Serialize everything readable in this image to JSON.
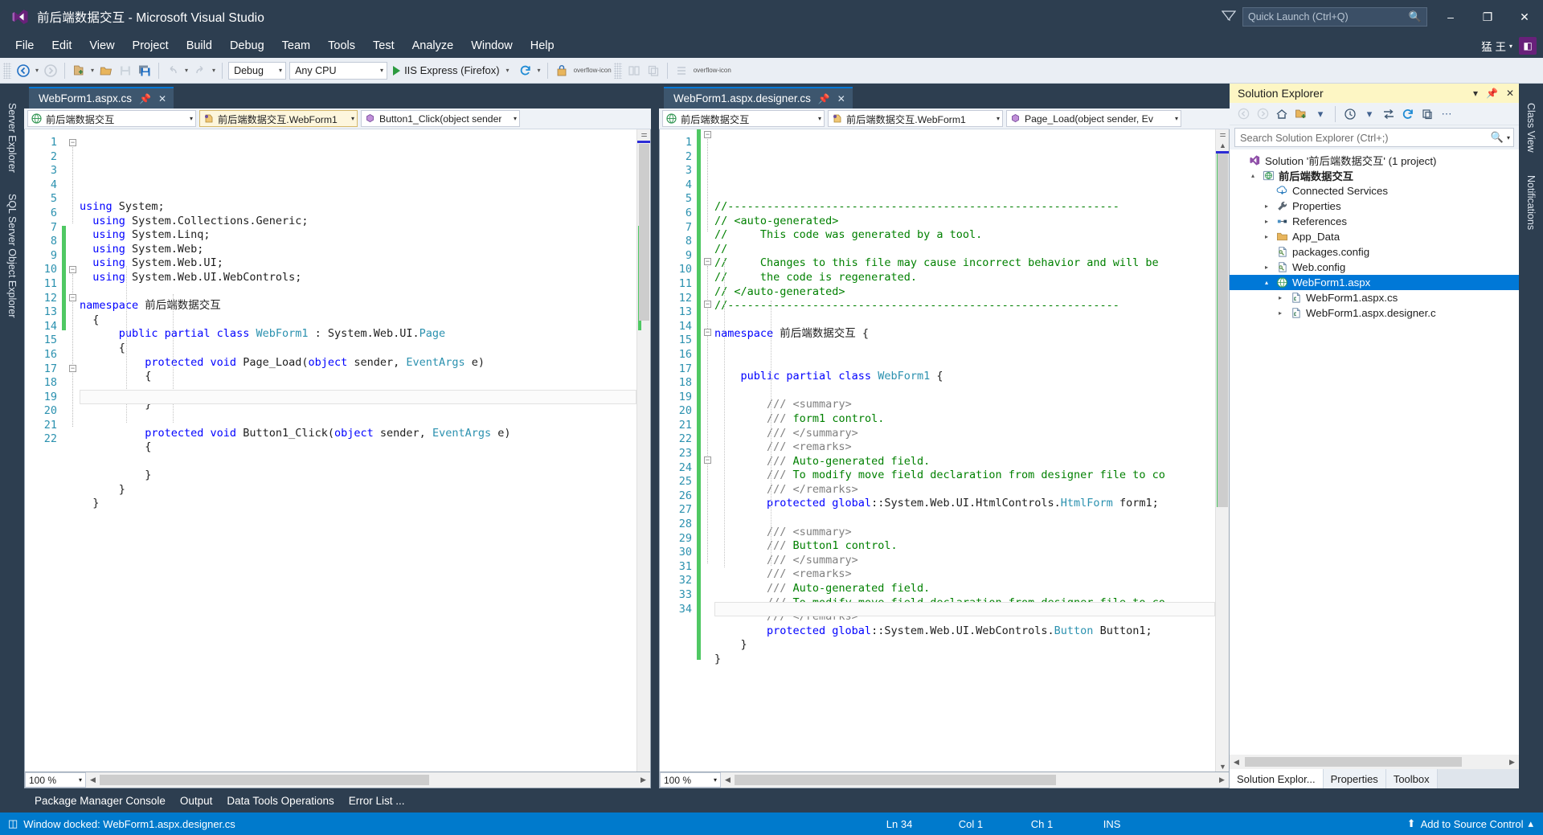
{
  "window": {
    "title": "前后端数据交互 - Microsoft Visual Studio",
    "logo_icon": "visual-studio-logo",
    "feedback_icon": "feedback-icon",
    "minimize_label": "–",
    "maximize_label": "❐",
    "close_label": "✕"
  },
  "quick_launch": {
    "placeholder": "Quick Launch (Ctrl+Q)",
    "icon": "search-icon"
  },
  "menu": {
    "items": [
      {
        "label": "File"
      },
      {
        "label": "Edit"
      },
      {
        "label": "View"
      },
      {
        "label": "Project"
      },
      {
        "label": "Build"
      },
      {
        "label": "Debug"
      },
      {
        "label": "Team"
      },
      {
        "label": "Tools"
      },
      {
        "label": "Test"
      },
      {
        "label": "Analyze"
      },
      {
        "label": "Window"
      },
      {
        "label": "Help"
      }
    ],
    "user": "猛 王",
    "user_caret": "▾",
    "badge": "◧"
  },
  "toolbar": {
    "nav_back_icon": "navigate-back-icon",
    "nav_forward_icon": "navigate-forward-icon",
    "new_project_icon": "new-project-icon",
    "open_file_icon": "open-file-icon",
    "save_icon": "save-icon",
    "save_all_icon": "save-all-icon",
    "undo_icon": "undo-icon",
    "redo_icon": "redo-icon",
    "config_value": "Debug",
    "platform_value": "Any CPU",
    "run_label": "IIS Express (Firefox)",
    "run_icon": "play-icon",
    "refresh_icon": "refresh-icon",
    "attach_icon": "attach-process-icon",
    "caret": "▾",
    "more_icon": "overflow-icon"
  },
  "left_pane": {
    "tab": {
      "label": "WebForm1.aspx.cs",
      "pin_icon": "pin-icon",
      "close_icon": "close-icon"
    },
    "nav": {
      "project": "前后端数据交互",
      "project_icon": "project-icon",
      "type": "前后端数据交互.WebForm1",
      "type_icon": "class-icon",
      "member": "Button1_Click(object sender",
      "member_icon": "method-icon",
      "caret": "▾"
    },
    "zoom": "100 %",
    "line_count": 22,
    "lines": [
      {
        "n": 1,
        "tokens": [
          {
            "t": "using ",
            "c": "kw"
          },
          {
            "t": "System;",
            "c": ""
          }
        ]
      },
      {
        "n": 2,
        "tokens": [
          {
            "t": "  using ",
            "c": "kw"
          },
          {
            "t": "System.Collections.Generic;",
            "c": ""
          }
        ]
      },
      {
        "n": 3,
        "tokens": [
          {
            "t": "  using ",
            "c": "kw"
          },
          {
            "t": "System.Linq;",
            "c": ""
          }
        ]
      },
      {
        "n": 4,
        "tokens": [
          {
            "t": "  using ",
            "c": "kw"
          },
          {
            "t": "System.Web;",
            "c": ""
          }
        ]
      },
      {
        "n": 5,
        "tokens": [
          {
            "t": "  using ",
            "c": "kw"
          },
          {
            "t": "System.Web.UI;",
            "c": ""
          }
        ]
      },
      {
        "n": 6,
        "tokens": [
          {
            "t": "  using ",
            "c": "kw"
          },
          {
            "t": "System.Web.UI.WebControls;",
            "c": ""
          }
        ]
      },
      {
        "n": 7,
        "tokens": []
      },
      {
        "n": 8,
        "tokens": [
          {
            "t": "namespace ",
            "c": "kw"
          },
          {
            "t": "前后端数据交互",
            "c": ""
          }
        ]
      },
      {
        "n": 9,
        "tokens": [
          {
            "t": "  {",
            "c": ""
          }
        ]
      },
      {
        "n": 10,
        "tokens": [
          {
            "t": "      public partial class ",
            "c": "kw"
          },
          {
            "t": "WebForm1",
            "c": "type"
          },
          {
            "t": " : System.Web.UI.",
            "c": ""
          },
          {
            "t": "Page",
            "c": "type"
          }
        ]
      },
      {
        "n": 11,
        "tokens": [
          {
            "t": "      {",
            "c": ""
          }
        ]
      },
      {
        "n": 12,
        "tokens": [
          {
            "t": "          protected void ",
            "c": "kw"
          },
          {
            "t": "Page_Load(",
            "c": ""
          },
          {
            "t": "object",
            "c": "kw"
          },
          {
            "t": " sender, ",
            "c": ""
          },
          {
            "t": "EventArgs",
            "c": "type"
          },
          {
            "t": " e)",
            "c": ""
          }
        ]
      },
      {
        "n": 13,
        "tokens": [
          {
            "t": "          {",
            "c": ""
          }
        ]
      },
      {
        "n": 14,
        "tokens": []
      },
      {
        "n": 15,
        "tokens": [
          {
            "t": "          }",
            "c": ""
          }
        ]
      },
      {
        "n": 16,
        "tokens": []
      },
      {
        "n": 17,
        "tokens": [
          {
            "t": "          protected void ",
            "c": "kw"
          },
          {
            "t": "Button1_Click(",
            "c": ""
          },
          {
            "t": "object",
            "c": "kw"
          },
          {
            "t": " sender, ",
            "c": ""
          },
          {
            "t": "EventArgs",
            "c": "type"
          },
          {
            "t": " e)",
            "c": ""
          }
        ]
      },
      {
        "n": 18,
        "tokens": [
          {
            "t": "          {",
            "c": ""
          }
        ]
      },
      {
        "n": 19,
        "tokens": []
      },
      {
        "n": 20,
        "tokens": [
          {
            "t": "          }",
            "c": ""
          }
        ]
      },
      {
        "n": 21,
        "tokens": [
          {
            "t": "      }",
            "c": ""
          }
        ]
      },
      {
        "n": 22,
        "tokens": [
          {
            "t": "  }",
            "c": ""
          }
        ]
      }
    ]
  },
  "right_pane": {
    "tab": {
      "label": "WebForm1.aspx.designer.cs",
      "pin_icon": "pin-icon",
      "close_icon": "close-icon"
    },
    "nav": {
      "project": "前后端数据交互",
      "project_icon": "project-icon",
      "type": "前后端数据交互.WebForm1",
      "type_icon": "class-icon",
      "member": "Page_Load(object sender, Ev",
      "member_icon": "method-icon",
      "caret": "▾"
    },
    "zoom": "100 %",
    "line_count": 34,
    "lines": [
      {
        "n": 1,
        "tokens": [
          {
            "t": "//------------------------------------------------------------",
            "c": "cmt"
          }
        ]
      },
      {
        "n": 2,
        "tokens": [
          {
            "t": "// <auto-generated>",
            "c": "cmt"
          }
        ]
      },
      {
        "n": 3,
        "tokens": [
          {
            "t": "//     This code was generated by a tool.",
            "c": "cmt"
          }
        ]
      },
      {
        "n": 4,
        "tokens": [
          {
            "t": "//",
            "c": "cmt"
          }
        ]
      },
      {
        "n": 5,
        "tokens": [
          {
            "t": "//     Changes to this file may cause incorrect behavior and will be ",
            "c": "cmt"
          }
        ]
      },
      {
        "n": 6,
        "tokens": [
          {
            "t": "//     the code is regenerated.",
            "c": "cmt"
          }
        ]
      },
      {
        "n": 7,
        "tokens": [
          {
            "t": "// </auto-generated>",
            "c": "cmt"
          }
        ]
      },
      {
        "n": 8,
        "tokens": [
          {
            "t": "//------------------------------------------------------------",
            "c": "cmt"
          }
        ]
      },
      {
        "n": 9,
        "tokens": []
      },
      {
        "n": 10,
        "tokens": [
          {
            "t": "namespace ",
            "c": "kw"
          },
          {
            "t": "前后端数据交互 {",
            "c": ""
          }
        ]
      },
      {
        "n": 11,
        "tokens": []
      },
      {
        "n": 12,
        "tokens": []
      },
      {
        "n": 13,
        "tokens": [
          {
            "t": "    public partial class ",
            "c": "kw"
          },
          {
            "t": "WebForm1",
            "c": "type"
          },
          {
            "t": " {",
            "c": ""
          }
        ]
      },
      {
        "n": 14,
        "tokens": []
      },
      {
        "n": 15,
        "tokens": [
          {
            "t": "        /// ",
            "c": "cmtdoc"
          },
          {
            "t": "<summary>",
            "c": "cmtdoc"
          }
        ]
      },
      {
        "n": 16,
        "tokens": [
          {
            "t": "        /// ",
            "c": "cmtdoc"
          },
          {
            "t": "form1 control.",
            "c": "cmt"
          }
        ]
      },
      {
        "n": 17,
        "tokens": [
          {
            "t": "        /// </summary>",
            "c": "cmtdoc"
          }
        ]
      },
      {
        "n": 18,
        "tokens": [
          {
            "t": "        /// <remarks>",
            "c": "cmtdoc"
          }
        ]
      },
      {
        "n": 19,
        "tokens": [
          {
            "t": "        /// ",
            "c": "cmtdoc"
          },
          {
            "t": "Auto-generated field.",
            "c": "cmt"
          }
        ]
      },
      {
        "n": 20,
        "tokens": [
          {
            "t": "        /// ",
            "c": "cmtdoc"
          },
          {
            "t": "To modify move field declaration from designer file to co",
            "c": "cmt"
          }
        ]
      },
      {
        "n": 21,
        "tokens": [
          {
            "t": "        /// </remarks>",
            "c": "cmtdoc"
          }
        ]
      },
      {
        "n": 22,
        "tokens": [
          {
            "t": "        protected global",
            "c": "kw"
          },
          {
            "t": "::System.Web.UI.HtmlControls.",
            "c": ""
          },
          {
            "t": "HtmlForm",
            "c": "type"
          },
          {
            "t": " form1;",
            "c": ""
          }
        ]
      },
      {
        "n": 23,
        "tokens": []
      },
      {
        "n": 24,
        "tokens": [
          {
            "t": "        /// <summary>",
            "c": "cmtdoc"
          }
        ]
      },
      {
        "n": 25,
        "tokens": [
          {
            "t": "        /// ",
            "c": "cmtdoc"
          },
          {
            "t": "Button1 control.",
            "c": "cmt"
          }
        ]
      },
      {
        "n": 26,
        "tokens": [
          {
            "t": "        /// </summary>",
            "c": "cmtdoc"
          }
        ]
      },
      {
        "n": 27,
        "tokens": [
          {
            "t": "        /// <remarks>",
            "c": "cmtdoc"
          }
        ]
      },
      {
        "n": 28,
        "tokens": [
          {
            "t": "        /// ",
            "c": "cmtdoc"
          },
          {
            "t": "Auto-generated field.",
            "c": "cmt"
          }
        ]
      },
      {
        "n": 29,
        "tokens": [
          {
            "t": "        /// ",
            "c": "cmtdoc"
          },
          {
            "t": "To modify move field declaration from designer file to co",
            "c": "cmt"
          }
        ]
      },
      {
        "n": 30,
        "tokens": [
          {
            "t": "        /// </remarks>",
            "c": "cmtdoc"
          }
        ]
      },
      {
        "n": 31,
        "tokens": [
          {
            "t": "        protected global",
            "c": "kw"
          },
          {
            "t": "::System.Web.UI.WebControls.",
            "c": ""
          },
          {
            "t": "Button",
            "c": "type"
          },
          {
            "t": " Button1;",
            "c": ""
          }
        ]
      },
      {
        "n": 32,
        "tokens": [
          {
            "t": "    }",
            "c": ""
          }
        ]
      },
      {
        "n": 33,
        "tokens": [
          {
            "t": "}",
            "c": ""
          }
        ]
      },
      {
        "n": 34,
        "tokens": []
      }
    ]
  },
  "left_dock": {
    "tabs": [
      "Server Explorer",
      "SQL Server Object Explorer"
    ]
  },
  "right_dock": {
    "tabs": [
      "Class View",
      "Notifications"
    ]
  },
  "solution_explorer": {
    "title": "Solution Explorer",
    "menu_caret": "▾",
    "pin_icon": "pin-icon",
    "close_icon": "close-icon",
    "toolbar_icons": [
      "back-icon",
      "forward-icon",
      "home-icon",
      "new-folder-icon",
      "dropdown-caret-icon",
      "pending-changes-icon",
      "sync-icon",
      "refresh-icon",
      "collapse-all-icon",
      "overflow-icon"
    ],
    "search_placeholder": "Search Solution Explorer (Ctrl+;)",
    "search_icon": "search-icon",
    "tree": [
      {
        "label": "Solution '前后端数据交互' (1 project)",
        "indent": 0,
        "arrow": "",
        "icon": "solution-icon",
        "selected": false,
        "bold": false
      },
      {
        "label": "前后端数据交互",
        "indent": 1,
        "arrow": "▴",
        "icon": "web-project-icon",
        "selected": false,
        "bold": true
      },
      {
        "label": "Connected Services",
        "indent": 2,
        "arrow": "",
        "icon": "connected-services-icon",
        "selected": false,
        "bold": false
      },
      {
        "label": "Properties",
        "indent": 2,
        "arrow": "▸",
        "icon": "wrench-icon",
        "selected": false,
        "bold": false
      },
      {
        "label": "References",
        "indent": 2,
        "arrow": "▸",
        "icon": "references-icon",
        "selected": false,
        "bold": false
      },
      {
        "label": "App_Data",
        "indent": 2,
        "arrow": "▸",
        "icon": "folder-icon",
        "selected": false,
        "bold": false
      },
      {
        "label": "packages.config",
        "indent": 2,
        "arrow": "",
        "icon": "config-file-icon",
        "selected": false,
        "bold": false
      },
      {
        "label": "Web.config",
        "indent": 2,
        "arrow": "▸",
        "icon": "config-file-icon",
        "selected": false,
        "bold": false
      },
      {
        "label": "WebForm1.aspx",
        "indent": 2,
        "arrow": "▴",
        "icon": "web-form-icon",
        "selected": true,
        "bold": false
      },
      {
        "label": "WebForm1.aspx.cs",
        "indent": 3,
        "arrow": "▸",
        "icon": "csharp-file-icon",
        "selected": false,
        "bold": false
      },
      {
        "label": "WebForm1.aspx.designer.c",
        "indent": 3,
        "arrow": "▸",
        "icon": "csharp-file-icon",
        "selected": false,
        "bold": false
      }
    ],
    "bottom_tabs": [
      {
        "label": "Solution Explor...",
        "active": true
      },
      {
        "label": "Properties",
        "active": false
      },
      {
        "label": "Toolbox",
        "active": false
      }
    ]
  },
  "bottom_dock": {
    "tabs": [
      "Package Manager Console",
      "Output",
      "Data Tools Operations",
      "Error List ..."
    ]
  },
  "status_bar": {
    "icon": "window-docked-icon",
    "message": "Window docked: WebForm1.aspx.designer.cs",
    "line": "Ln 34",
    "col": "Col 1",
    "ch": "Ch 1",
    "insert_mode": "INS",
    "source_control": "Add to Source Control",
    "source_control_icon": "upload-icon",
    "source_control_caret": "▴"
  },
  "colors": {
    "chrome": "#2d3e50",
    "accent": "#007acc",
    "tab_active": "#3d566e",
    "selection": "#0078d7",
    "title_highlight": "#fdf6c4",
    "keyword": "#0000ff",
    "type": "#2b91af",
    "comment": "#008000",
    "doc_comment": "#808080",
    "change_marker": "#4fc863"
  }
}
